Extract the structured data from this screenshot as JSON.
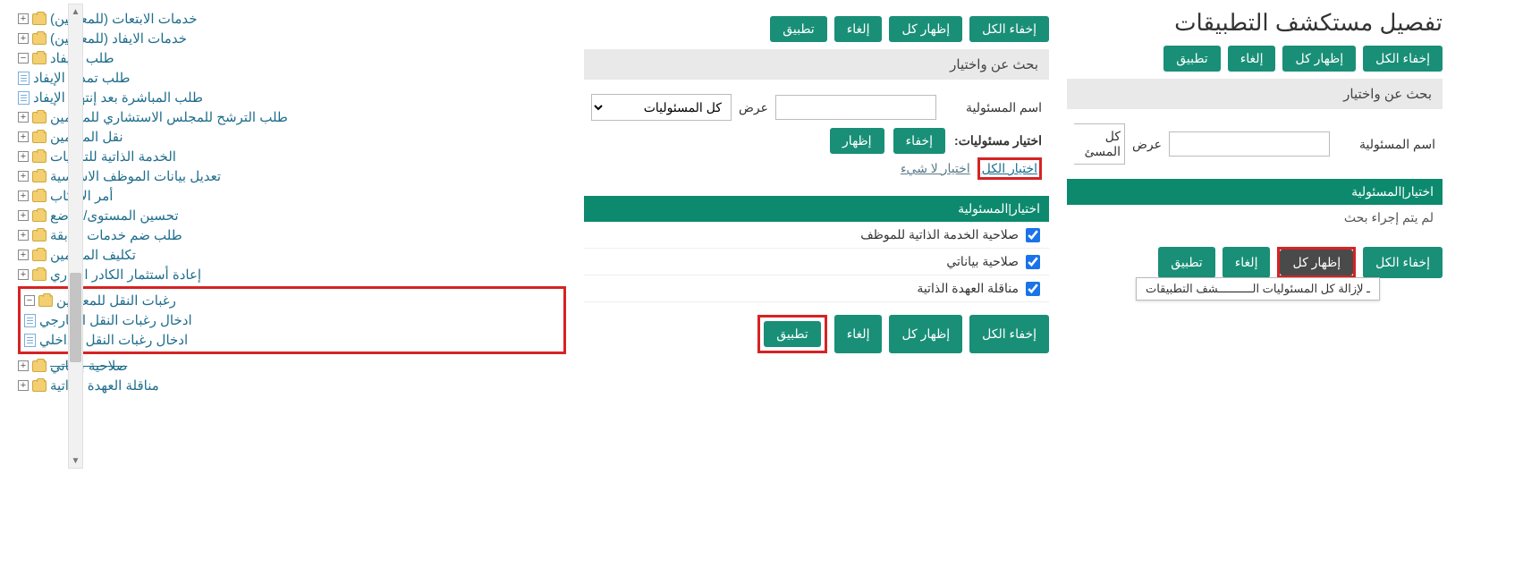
{
  "page_title": "تفصيل مستكشف التطبيقات",
  "buttons": {
    "hide_all": "إخفاء الكل",
    "show_all": "إظهار كل",
    "cancel": "إلغاء",
    "apply": "تطبيق",
    "hide": "إخفاء",
    "show": "إظهار"
  },
  "search_panel": {
    "title": "بحث عن واختيار",
    "resp_name_label": "اسم المسئولية",
    "display_label": "عرض",
    "all_resp_option": "كل المسئوليات",
    "all_resp_short": "كل المسئ"
  },
  "right": {
    "select_header": "اختيار|المسئولية",
    "no_search": "لم يتم إجراء بحث"
  },
  "tooltip_text": "ـ لإزالة كل المسئوليات الــــــــــشف التطبيقات",
  "mid": {
    "choose_label": "اختيار مسئوليات:",
    "select_all": "اختيار الكل",
    "select_none": "اختيار لا شيء",
    "table_header": "اختيار|المسئولية",
    "items": [
      "صلاحية الخدمة الذاتية للموظف",
      "صلاحية بياناتي",
      "مناقلة العهدة الذاتية"
    ]
  },
  "tree": [
    {
      "t": "folder",
      "exp": "plus",
      "lvl": 0,
      "label": "خدمات الابتعات (للمعلمين)"
    },
    {
      "t": "folder",
      "exp": "plus",
      "lvl": 0,
      "label": "خدمات الايفاد (للمعلمين)"
    },
    {
      "t": "folder",
      "exp": "minus",
      "lvl": 0,
      "label": "طلب الايفاد"
    },
    {
      "t": "doc",
      "lvl": 1,
      "label": "طلب تمديد الإيفاد"
    },
    {
      "t": "doc",
      "lvl": 1,
      "label": "طلب المباشرة بعد إنتهاء الإيفاد"
    },
    {
      "t": "folder",
      "exp": "plus",
      "lvl": 0,
      "label": "طلب الترشح للمجلس الاستشاري للمعلمين"
    },
    {
      "t": "folder",
      "exp": "plus",
      "lvl": 0,
      "label": "نقل المعلمين"
    },
    {
      "t": "folder",
      "exp": "plus",
      "lvl": 0,
      "label": "الخدمة الذاتية للترقيات"
    },
    {
      "t": "folder",
      "exp": "plus",
      "lvl": 0,
      "label": "تعديل بيانات الموظف الاساسية"
    },
    {
      "t": "folder",
      "exp": "plus",
      "lvl": 0,
      "label": "أمر الاركاب"
    },
    {
      "t": "folder",
      "exp": "plus",
      "lvl": 0,
      "label": "تحسين المستوى/الوضع"
    },
    {
      "t": "folder",
      "exp": "plus",
      "lvl": 0,
      "label": "طلب ضم خدمات سابقة"
    },
    {
      "t": "folder",
      "exp": "plus",
      "lvl": 0,
      "label": "تكليف المعلمين"
    },
    {
      "t": "folder",
      "exp": "plus",
      "lvl": 0,
      "label": "إعادة أستثمار الكادر الإداري"
    },
    {
      "t": "folder",
      "exp": "minus",
      "lvl": 0,
      "label": "رغبات النقل للمعلمين",
      "hl": true
    },
    {
      "t": "doc",
      "lvl": 1,
      "label": "ادخال رغبات النقل الخارجي",
      "hl": true
    },
    {
      "t": "doc",
      "lvl": 1,
      "label": "ادخال رغبات النقل الداخلي",
      "hl": true
    },
    {
      "t": "folder",
      "exp": "plus",
      "lvl": 0,
      "label": "صلاحية بياناتي",
      "strike": true
    },
    {
      "t": "folder",
      "exp": "plus",
      "lvl": 0,
      "label": "مناقلة العهدة الذاتية"
    }
  ]
}
